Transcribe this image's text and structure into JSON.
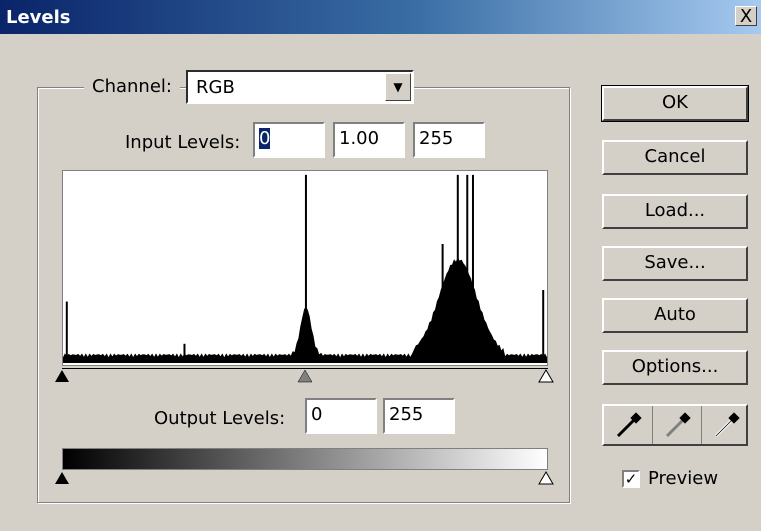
{
  "window": {
    "title": "Levels",
    "close_glyph": "X"
  },
  "channel": {
    "label": "Channel:",
    "value": "RGB"
  },
  "input_levels": {
    "label": "Input Levels:",
    "black": "0",
    "gamma": "1.00",
    "white": "255"
  },
  "output_levels": {
    "label": "Output Levels:",
    "black": "0",
    "white": "255"
  },
  "buttons": {
    "ok": "OK",
    "cancel": "Cancel",
    "load": "Load...",
    "save": "Save...",
    "auto": "Auto",
    "options": "Options..."
  },
  "eyedroppers": [
    "black-point-eyedropper-icon",
    "gray-point-eyedropper-icon",
    "white-point-eyedropper-icon"
  ],
  "preview": {
    "label": "Preview",
    "checked": true
  },
  "histogram": {
    "x_range": [
      0,
      255
    ],
    "peaks": [
      {
        "level": 2,
        "height": 0.32
      },
      {
        "level": 64,
        "height": 0.1
      },
      {
        "level": 128,
        "height": 0.98
      },
      {
        "level": 200,
        "height": 0.62
      },
      {
        "level": 208,
        "height": 0.98
      },
      {
        "level": 213,
        "height": 0.98
      },
      {
        "level": 216,
        "height": 0.98
      },
      {
        "level": 253,
        "height": 0.38
      }
    ]
  },
  "colors": {
    "title_start": "#0a246a",
    "title_end": "#a6caf0",
    "dialog_bg": "#d4d0c8"
  }
}
